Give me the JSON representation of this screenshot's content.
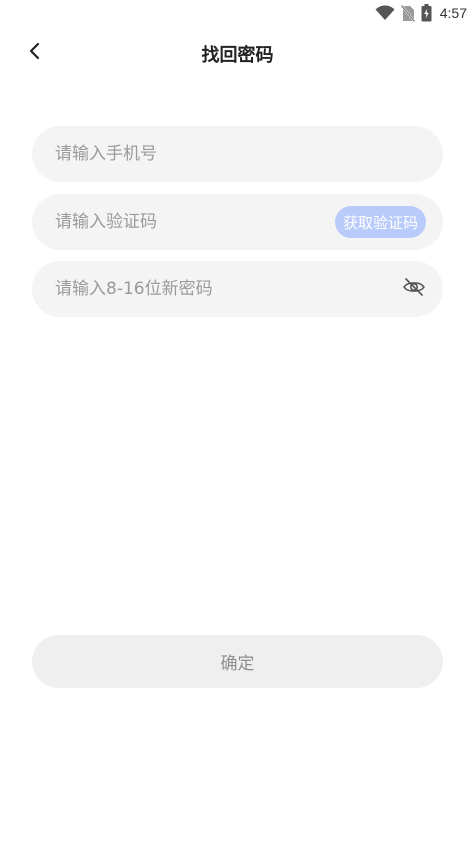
{
  "status_bar": {
    "time": "4:57",
    "icons": [
      "wifi-icon",
      "no-sim-icon",
      "battery-charging-icon"
    ]
  },
  "header": {
    "title": "找回密码",
    "back_icon": "chevron-left-icon"
  },
  "form": {
    "phone": {
      "placeholder": "请输入手机号",
      "value": ""
    },
    "code": {
      "placeholder": "请输入验证码",
      "value": "",
      "get_code_label": "获取验证码"
    },
    "password": {
      "placeholder": "请输入8-16位新密码",
      "value": "",
      "toggle_icon": "eye-off-icon"
    }
  },
  "confirm": {
    "label": "确定"
  },
  "colors": {
    "accent_disabled": "#b9cbfb",
    "field_bg": "#f4f4f4",
    "button_disabled_bg": "#efefef"
  }
}
